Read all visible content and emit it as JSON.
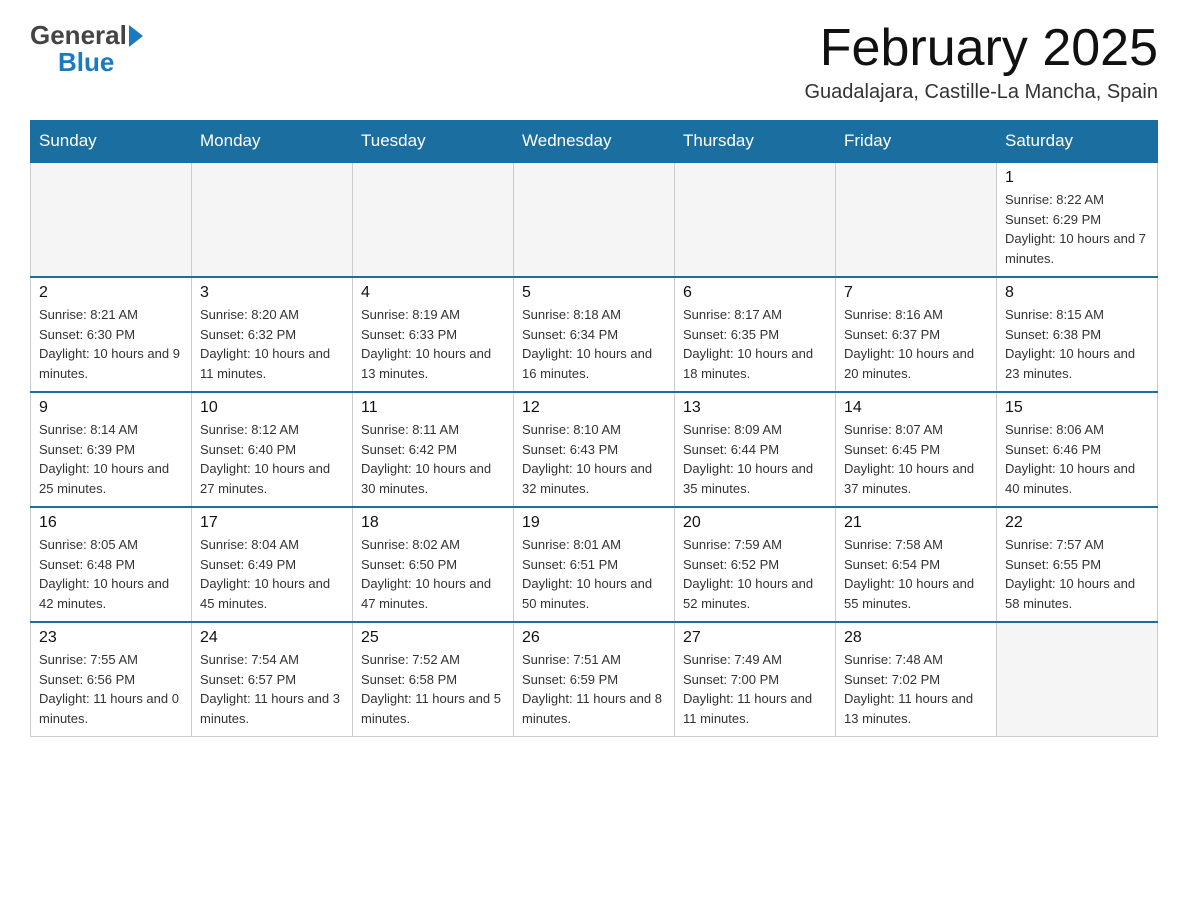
{
  "header": {
    "logo_general": "General",
    "logo_blue": "Blue",
    "month_title": "February 2025",
    "location": "Guadalajara, Castille-La Mancha, Spain"
  },
  "days_of_week": [
    "Sunday",
    "Monday",
    "Tuesday",
    "Wednesday",
    "Thursday",
    "Friday",
    "Saturday"
  ],
  "weeks": [
    [
      {
        "day": "",
        "info": ""
      },
      {
        "day": "",
        "info": ""
      },
      {
        "day": "",
        "info": ""
      },
      {
        "day": "",
        "info": ""
      },
      {
        "day": "",
        "info": ""
      },
      {
        "day": "",
        "info": ""
      },
      {
        "day": "1",
        "info": "Sunrise: 8:22 AM\nSunset: 6:29 PM\nDaylight: 10 hours and 7 minutes."
      }
    ],
    [
      {
        "day": "2",
        "info": "Sunrise: 8:21 AM\nSunset: 6:30 PM\nDaylight: 10 hours and 9 minutes."
      },
      {
        "day": "3",
        "info": "Sunrise: 8:20 AM\nSunset: 6:32 PM\nDaylight: 10 hours and 11 minutes."
      },
      {
        "day": "4",
        "info": "Sunrise: 8:19 AM\nSunset: 6:33 PM\nDaylight: 10 hours and 13 minutes."
      },
      {
        "day": "5",
        "info": "Sunrise: 8:18 AM\nSunset: 6:34 PM\nDaylight: 10 hours and 16 minutes."
      },
      {
        "day": "6",
        "info": "Sunrise: 8:17 AM\nSunset: 6:35 PM\nDaylight: 10 hours and 18 minutes."
      },
      {
        "day": "7",
        "info": "Sunrise: 8:16 AM\nSunset: 6:37 PM\nDaylight: 10 hours and 20 minutes."
      },
      {
        "day": "8",
        "info": "Sunrise: 8:15 AM\nSunset: 6:38 PM\nDaylight: 10 hours and 23 minutes."
      }
    ],
    [
      {
        "day": "9",
        "info": "Sunrise: 8:14 AM\nSunset: 6:39 PM\nDaylight: 10 hours and 25 minutes."
      },
      {
        "day": "10",
        "info": "Sunrise: 8:12 AM\nSunset: 6:40 PM\nDaylight: 10 hours and 27 minutes."
      },
      {
        "day": "11",
        "info": "Sunrise: 8:11 AM\nSunset: 6:42 PM\nDaylight: 10 hours and 30 minutes."
      },
      {
        "day": "12",
        "info": "Sunrise: 8:10 AM\nSunset: 6:43 PM\nDaylight: 10 hours and 32 minutes."
      },
      {
        "day": "13",
        "info": "Sunrise: 8:09 AM\nSunset: 6:44 PM\nDaylight: 10 hours and 35 minutes."
      },
      {
        "day": "14",
        "info": "Sunrise: 8:07 AM\nSunset: 6:45 PM\nDaylight: 10 hours and 37 minutes."
      },
      {
        "day": "15",
        "info": "Sunrise: 8:06 AM\nSunset: 6:46 PM\nDaylight: 10 hours and 40 minutes."
      }
    ],
    [
      {
        "day": "16",
        "info": "Sunrise: 8:05 AM\nSunset: 6:48 PM\nDaylight: 10 hours and 42 minutes."
      },
      {
        "day": "17",
        "info": "Sunrise: 8:04 AM\nSunset: 6:49 PM\nDaylight: 10 hours and 45 minutes."
      },
      {
        "day": "18",
        "info": "Sunrise: 8:02 AM\nSunset: 6:50 PM\nDaylight: 10 hours and 47 minutes."
      },
      {
        "day": "19",
        "info": "Sunrise: 8:01 AM\nSunset: 6:51 PM\nDaylight: 10 hours and 50 minutes."
      },
      {
        "day": "20",
        "info": "Sunrise: 7:59 AM\nSunset: 6:52 PM\nDaylight: 10 hours and 52 minutes."
      },
      {
        "day": "21",
        "info": "Sunrise: 7:58 AM\nSunset: 6:54 PM\nDaylight: 10 hours and 55 minutes."
      },
      {
        "day": "22",
        "info": "Sunrise: 7:57 AM\nSunset: 6:55 PM\nDaylight: 10 hours and 58 minutes."
      }
    ],
    [
      {
        "day": "23",
        "info": "Sunrise: 7:55 AM\nSunset: 6:56 PM\nDaylight: 11 hours and 0 minutes."
      },
      {
        "day": "24",
        "info": "Sunrise: 7:54 AM\nSunset: 6:57 PM\nDaylight: 11 hours and 3 minutes."
      },
      {
        "day": "25",
        "info": "Sunrise: 7:52 AM\nSunset: 6:58 PM\nDaylight: 11 hours and 5 minutes."
      },
      {
        "day": "26",
        "info": "Sunrise: 7:51 AM\nSunset: 6:59 PM\nDaylight: 11 hours and 8 minutes."
      },
      {
        "day": "27",
        "info": "Sunrise: 7:49 AM\nSunset: 7:00 PM\nDaylight: 11 hours and 11 minutes."
      },
      {
        "day": "28",
        "info": "Sunrise: 7:48 AM\nSunset: 7:02 PM\nDaylight: 11 hours and 13 minutes."
      },
      {
        "day": "",
        "info": ""
      }
    ]
  ]
}
